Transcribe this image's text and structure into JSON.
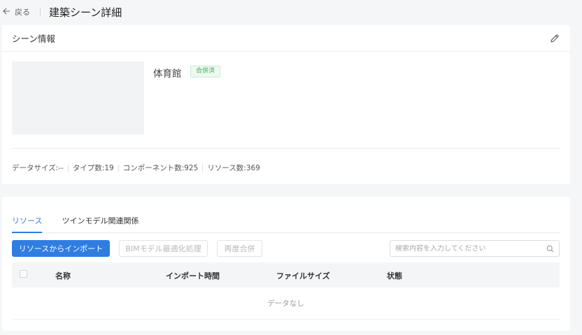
{
  "header": {
    "back_label": "戻る",
    "title": "建築シーン詳細"
  },
  "info_card": {
    "title": "シーン情報",
    "scene_name": "体育館",
    "status": "合併済",
    "stats": [
      "データサイズ:--",
      "タイプ数:19",
      "コンポーネント数:925",
      "リソース数:369"
    ]
  },
  "resource_card": {
    "tabs": [
      {
        "label": "リソース",
        "active": true
      },
      {
        "label": "ツインモデル関連関係",
        "active": false
      }
    ],
    "buttons": {
      "import": "リソースからインポート",
      "bim_optimize": "BIMモデル最適化処理",
      "remerge": "再度合併"
    },
    "search": {
      "placeholder": "検索内容を入力してください",
      "value": ""
    },
    "table": {
      "columns": [
        "名称",
        "インポート時間",
        "ファイルサイズ",
        "状態"
      ],
      "rows": [],
      "empty_text": "データなし"
    }
  },
  "colors": {
    "accent": "#2f7de1",
    "status_green": "#3fae5a",
    "background": "#f5f6f8"
  }
}
